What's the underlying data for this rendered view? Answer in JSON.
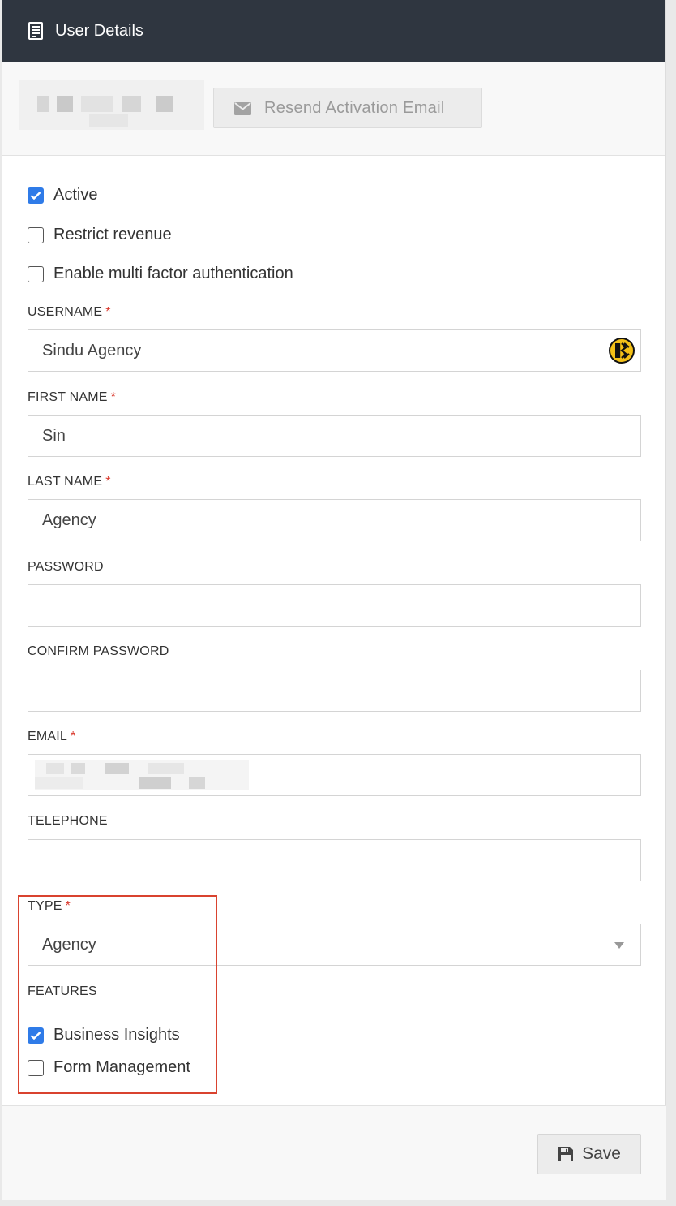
{
  "header": {
    "title": "User Details",
    "icon": "document-icon"
  },
  "topbar": {
    "resend_label": "Resend Activation Email"
  },
  "checkboxes": {
    "active": {
      "label": "Active",
      "checked": true
    },
    "restrict_revenue": {
      "label": "Restrict revenue",
      "checked": false
    },
    "mfa": {
      "label": "Enable multi factor authentication",
      "checked": false
    }
  },
  "fields": {
    "username": {
      "label": "USERNAME",
      "required": "*",
      "value": "Sindu Agency"
    },
    "first_name": {
      "label": "FIRST NAME",
      "required": "*",
      "value": "Sin"
    },
    "last_name": {
      "label": "LAST NAME",
      "required": "*",
      "value": "Agency"
    },
    "password": {
      "label": "PASSWORD",
      "value": ""
    },
    "confirm_password": {
      "label": "CONFIRM PASSWORD",
      "value": ""
    },
    "email": {
      "label": "EMAIL",
      "required": "*",
      "value": ""
    },
    "telephone": {
      "label": "TELEPHONE",
      "value": ""
    },
    "type": {
      "label": "TYPE",
      "required": "*",
      "value": "Agency"
    }
  },
  "features": {
    "label": "FEATURES",
    "items": [
      {
        "label": "Business Insights",
        "checked": true
      },
      {
        "label": "Form Management",
        "checked": false
      }
    ]
  },
  "footer": {
    "save_label": "Save"
  },
  "colors": {
    "header_bg": "#2f3640",
    "accent": "#2f7be8",
    "required": "#d9372b",
    "highlight": "#d9432f"
  }
}
